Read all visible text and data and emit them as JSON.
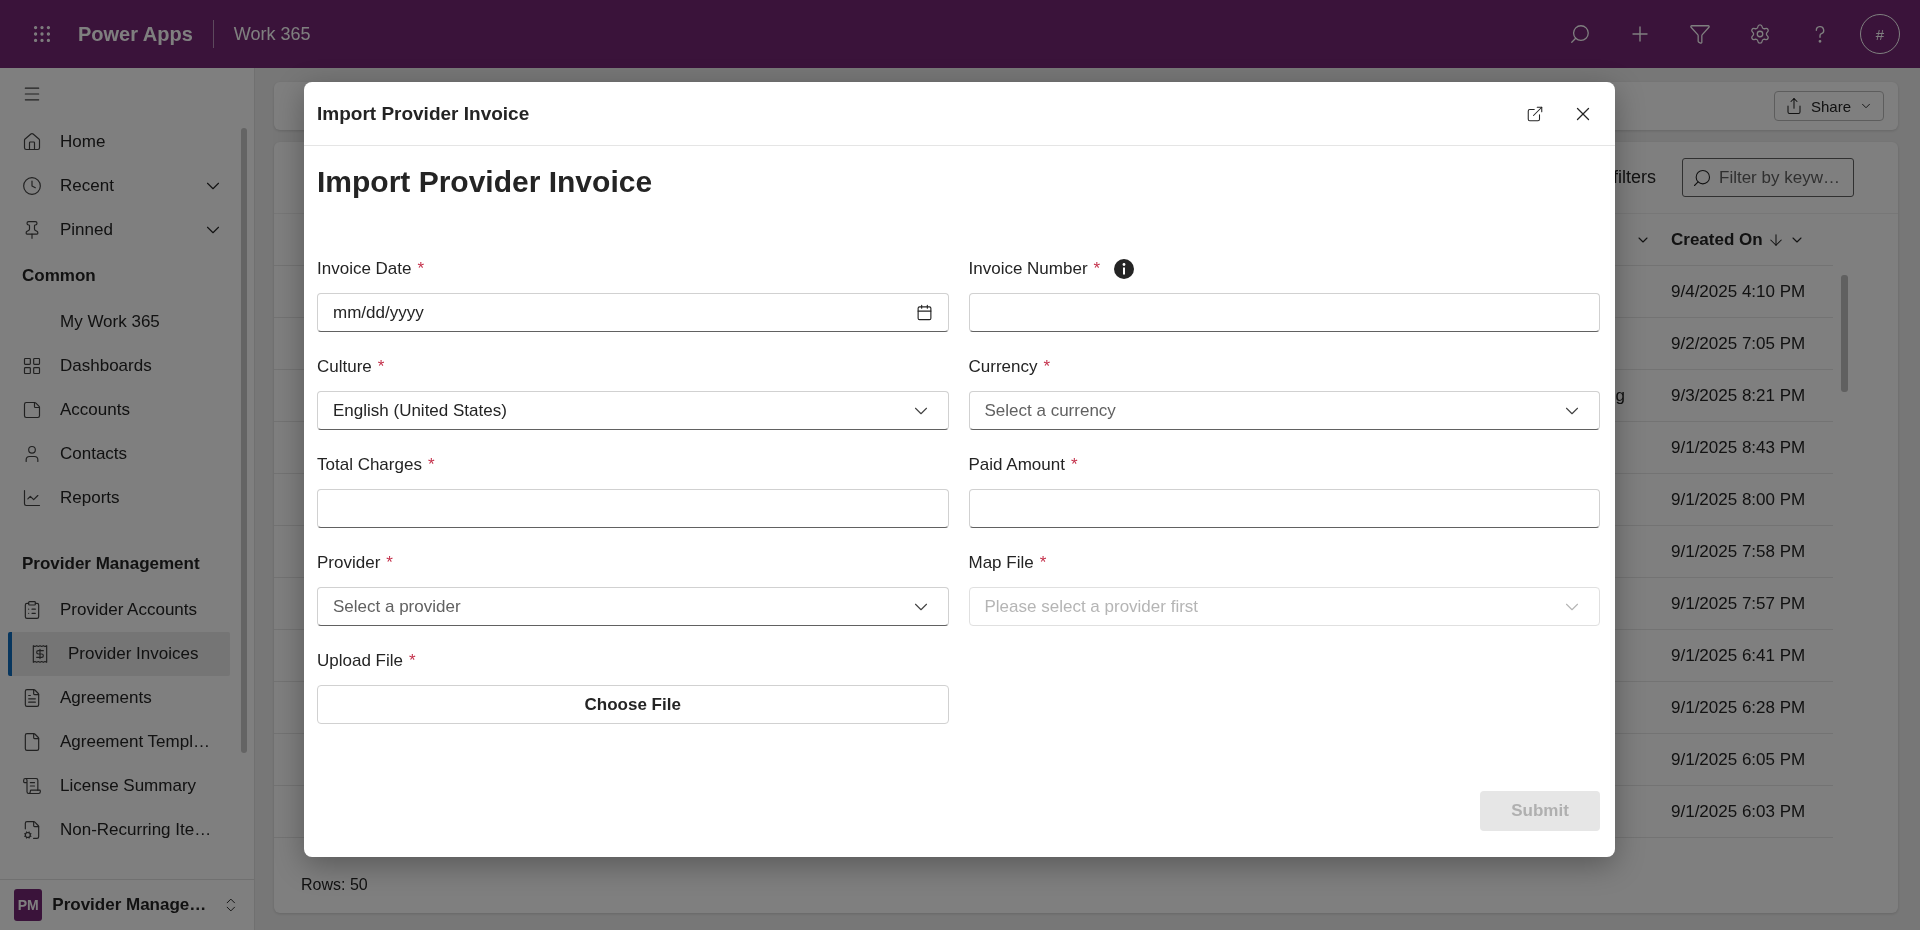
{
  "app_bar": {
    "app_name": "Power Apps",
    "environment": "Work 365",
    "user_initials": "#"
  },
  "sidebar": {
    "groups": [
      {
        "items": [
          {
            "label": "Home",
            "selected": false
          },
          {
            "label": "Recent",
            "selected": false,
            "expanded": false
          },
          {
            "label": "Pinned",
            "selected": false,
            "expanded": false
          }
        ]
      },
      {
        "title": "Common",
        "items": [
          {
            "label": "My Work 365",
            "selected": false
          },
          {
            "label": "Dashboards",
            "selected": false
          },
          {
            "label": "Accounts",
            "selected": false
          },
          {
            "label": "Contacts",
            "selected": false
          },
          {
            "label": "Reports",
            "selected": false
          }
        ]
      },
      {
        "title": "Provider Management",
        "items": [
          {
            "label": "Provider Accounts",
            "selected": false
          },
          {
            "label": "Provider Invoices",
            "selected": true
          },
          {
            "label": "Agreements",
            "selected": false
          },
          {
            "label": "Agreement Templ…",
            "selected": false
          },
          {
            "label": "License Summary",
            "selected": false
          },
          {
            "label": "Non-Recurring Ite…",
            "selected": false
          }
        ]
      }
    ],
    "area_switcher": {
      "badge": "PM",
      "label": "Provider Manage…"
    }
  },
  "command_bar": {
    "share": "Share"
  },
  "grid": {
    "filters_label": "filters",
    "filter_placeholder": "Filter by keyw…",
    "column": {
      "label": "Created On",
      "sort_descending": true
    },
    "rows": [
      {
        "created_on": "9/4/2025 4:10 PM"
      },
      {
        "created_on": "9/2/2025 7:05 PM"
      },
      {
        "column_1": "g",
        "created_on": "9/3/2025 8:21 PM"
      },
      {
        "created_on": "9/1/2025 8:43 PM"
      },
      {
        "created_on": "9/1/2025 8:00 PM"
      },
      {
        "created_on": "9/1/2025 7:58 PM"
      },
      {
        "created_on": "9/1/2025 7:57 PM"
      },
      {
        "created_on": "9/1/2025 6:41 PM"
      },
      {
        "created_on": "9/1/2025 6:28 PM"
      },
      {
        "created_on": "9/1/2025 6:05 PM"
      },
      {
        "created_on": "9/1/2025 6:03 PM"
      }
    ],
    "row_count": "Rows: 50"
  },
  "dialog": {
    "window_title": "Import Provider Invoice",
    "heading": "Import Provider Invoice",
    "fields": [
      {
        "kind": "date",
        "label": "Invoice Date",
        "required_mark": "*",
        "placeholder": "mm/dd/yyyy",
        "info": false,
        "disabled": false
      },
      {
        "kind": "text",
        "label": "Invoice Number",
        "required_mark": "*",
        "info": true,
        "disabled": false
      },
      {
        "kind": "select",
        "label": "Culture",
        "required_mark": "*",
        "value": "English (United States)",
        "info": false,
        "disabled": false
      },
      {
        "kind": "select",
        "label": "Currency",
        "required_mark": "*",
        "placeholder": "Select a currency",
        "info": false,
        "disabled": false
      },
      {
        "kind": "text",
        "label": "Total Charges",
        "required_mark": "*",
        "info": false,
        "disabled": false
      },
      {
        "kind": "text",
        "label": "Paid Amount",
        "required_mark": "*",
        "info": false,
        "disabled": false
      },
      {
        "kind": "select",
        "label": "Provider",
        "required_mark": "*",
        "placeholder": "Select a provider",
        "info": false,
        "disabled": false
      },
      {
        "kind": "select",
        "label": "Map File",
        "required_mark": "*",
        "placeholder": "Please select a provider first",
        "info": false,
        "disabled": true
      },
      {
        "kind": "file",
        "label": "Upload File",
        "required_mark": "*",
        "button": "Choose File",
        "info": false,
        "disabled": false
      }
    ],
    "submit": {
      "label": "Submit",
      "disabled": true
    }
  }
}
